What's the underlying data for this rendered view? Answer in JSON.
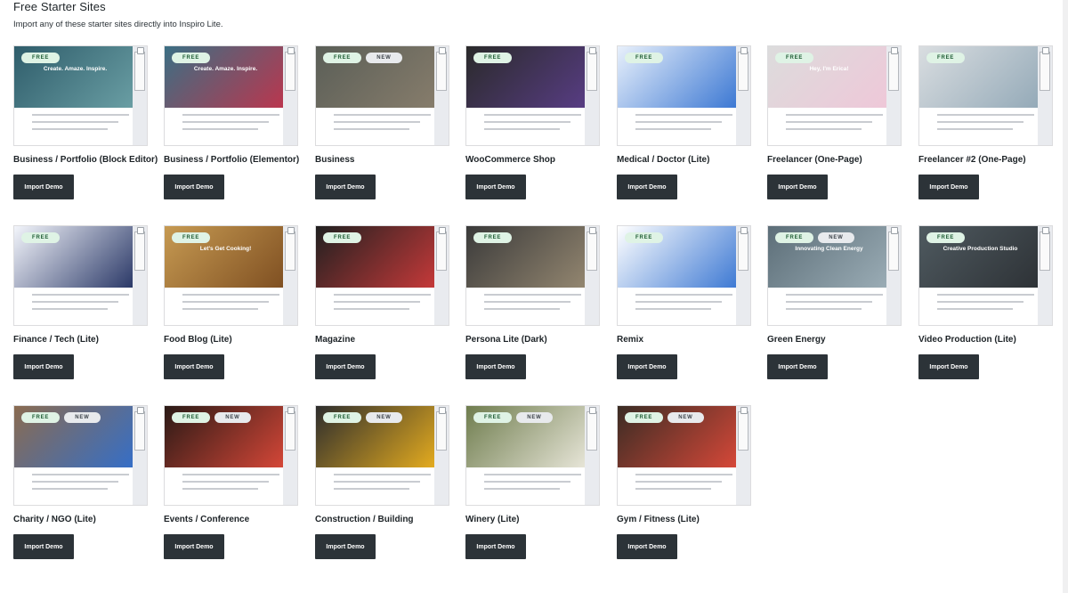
{
  "header": {
    "title": "Free Starter Sites",
    "subtitle": "Import any of these starter sites directly into Inspiro Lite."
  },
  "badge_labels": {
    "free": "FREE",
    "new": "NEW"
  },
  "button_label": "Import Demo",
  "sites": [
    {
      "title": "Business / Portfolio (Block Editor)",
      "badges": [
        "free"
      ],
      "hero_text": "Create. Amaze. Inspire.",
      "colors": {
        "hero": "#2f5d6b",
        "accent": "#6ea3a8"
      }
    },
    {
      "title": "Business / Portfolio (Elementor)",
      "badges": [
        "free"
      ],
      "hero_text": "Create. Amaze. Inspire.",
      "colors": {
        "hero": "#3b6f84",
        "accent": "#c4324a"
      }
    },
    {
      "title": "Business",
      "badges": [
        "free",
        "new"
      ],
      "hero_text": "",
      "colors": {
        "hero": "#5a5e57",
        "accent": "#8a7f6d"
      }
    },
    {
      "title": "WooCommerce Shop",
      "badges": [
        "free"
      ],
      "hero_text": "",
      "colors": {
        "hero": "#2a2a2a",
        "accent": "#5b3e8a"
      }
    },
    {
      "title": "Medical / Doctor (Lite)",
      "badges": [
        "free"
      ],
      "hero_text": "",
      "colors": {
        "hero": "#e8f0fb",
        "accent": "#2f6fd0"
      }
    },
    {
      "title": "Freelancer (One-Page)",
      "badges": [
        "free"
      ],
      "hero_text": "Hey, I'm Erica!",
      "colors": {
        "hero": "#dcdcdc",
        "accent": "#f0c6d8"
      }
    },
    {
      "title": "Freelancer #2 (One-Page)",
      "badges": [
        "free"
      ],
      "hero_text": "",
      "colors": {
        "hero": "#d9dde0",
        "accent": "#8fa6b5"
      }
    },
    {
      "title": "Finance / Tech (Lite)",
      "badges": [
        "free"
      ],
      "hero_text": "",
      "colors": {
        "hero": "#f3f5fb",
        "accent": "#1b2a5c"
      }
    },
    {
      "title": "Food Blog (Lite)",
      "badges": [
        "free"
      ],
      "hero_text": "Let's Get Cooking!",
      "colors": {
        "hero": "#c69a52",
        "accent": "#7a4a1e"
      }
    },
    {
      "title": "Magazine",
      "badges": [
        "free"
      ],
      "hero_text": "",
      "colors": {
        "hero": "#202020",
        "accent": "#d23b3b"
      }
    },
    {
      "title": "Persona Lite (Dark)",
      "badges": [
        "free"
      ],
      "hero_text": "",
      "colors": {
        "hero": "#3a3a3a",
        "accent": "#9a8c74"
      }
    },
    {
      "title": "Remix",
      "badges": [
        "free"
      ],
      "hero_text": "",
      "colors": {
        "hero": "#ffffff",
        "accent": "#2f6fd0"
      }
    },
    {
      "title": "Green Energy",
      "badges": [
        "free",
        "new"
      ],
      "hero_text": "Innovating Clean Energy",
      "colors": {
        "hero": "#5c6e78",
        "accent": "#9fb1ba"
      }
    },
    {
      "title": "Video Production (Lite)",
      "badges": [
        "free"
      ],
      "hero_text": "Creative Production Studio",
      "colors": {
        "hero": "#4f5a60",
        "accent": "#2b2f33"
      }
    },
    {
      "title": "Charity / NGO (Lite)",
      "badges": [
        "free",
        "new"
      ],
      "hero_text": "",
      "colors": {
        "hero": "#8a6b50",
        "accent": "#2f6fd0"
      }
    },
    {
      "title": "Events / Conference",
      "badges": [
        "free",
        "new"
      ],
      "hero_text": "",
      "colors": {
        "hero": "#2a1a16",
        "accent": "#e24a3a"
      }
    },
    {
      "title": "Construction / Building",
      "badges": [
        "free",
        "new"
      ],
      "hero_text": "",
      "colors": {
        "hero": "#2d2d2d",
        "accent": "#f2b51e"
      }
    },
    {
      "title": "Winery (Lite)",
      "badges": [
        "free",
        "new"
      ],
      "hero_text": "",
      "colors": {
        "hero": "#6f7d4e",
        "accent": "#f0ede2"
      }
    },
    {
      "title": "Gym / Fitness (Lite)",
      "badges": [
        "free",
        "new"
      ],
      "hero_text": "",
      "colors": {
        "hero": "#3a2c24",
        "accent": "#e24a3a"
      }
    }
  ]
}
